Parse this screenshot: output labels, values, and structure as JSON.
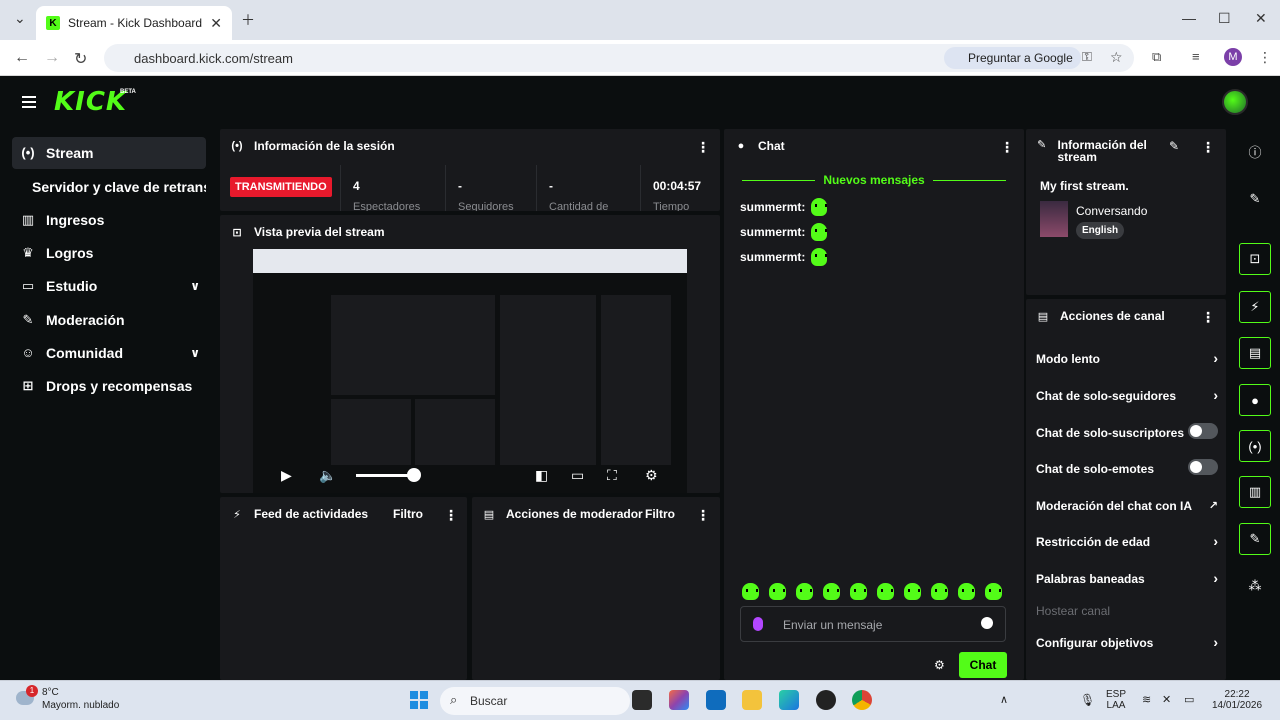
{
  "browser": {
    "tab_title": "Stream - Kick Dashboard",
    "url": "dashboard.kick.com/stream",
    "ask_google": "Preguntar a Google",
    "profile_letter": "M"
  },
  "app": {
    "logo": "KICK",
    "beta": "BETA"
  },
  "sidebar": {
    "items": [
      {
        "label": "Stream"
      },
      {
        "label": "Servidor y clave de retransmisión"
      },
      {
        "label": "Ingresos"
      },
      {
        "label": "Logros"
      },
      {
        "label": "Estudio"
      },
      {
        "label": "Moderación"
      },
      {
        "label": "Comunidad"
      },
      {
        "label": "Drops y recompensas"
      }
    ]
  },
  "session": {
    "title": "Información de la sesión",
    "live_badge": "TRANSMITIENDO",
    "stats": [
      {
        "value": "4",
        "label": "Espectadores"
      },
      {
        "value": "-",
        "label": "Seguidores"
      },
      {
        "value": "-",
        "label": "Cantidad de"
      },
      {
        "value": "00:04:57",
        "label": "Tiempo"
      }
    ]
  },
  "preview": {
    "title": "Vista previa del stream"
  },
  "activity": {
    "title": "Feed de actividades",
    "filter": "Filtro"
  },
  "mod_actions": {
    "title": "Acciones de moderador",
    "filter": "Filtro"
  },
  "chat": {
    "title": "Chat",
    "new_messages": "Nuevos mensajes",
    "messages": [
      {
        "user": "summermt:"
      },
      {
        "user": "summermt:"
      },
      {
        "user": "summermt:"
      }
    ],
    "input_placeholder": "Enviar un mensaje",
    "send_label": "Chat"
  },
  "stream_info": {
    "title": "Información del stream",
    "stream_title": "My first stream.",
    "category": "Conversando",
    "language": "English"
  },
  "channel_actions": {
    "title": "Acciones de canal",
    "items": [
      {
        "label": "Modo lento",
        "control": "chevron"
      },
      {
        "label": "Chat de solo-seguidores",
        "control": "chevron"
      },
      {
        "label": "Chat de solo-suscriptores",
        "control": "toggle"
      },
      {
        "label": "Chat de solo-emotes",
        "control": "toggle"
      },
      {
        "label": "Moderación del chat con IA",
        "control": "external"
      },
      {
        "label": "Restricción de edad",
        "control": "chevron"
      },
      {
        "label": "Palabras baneadas",
        "control": "chevron"
      },
      {
        "label": "Hostear canal",
        "control": "none"
      },
      {
        "label": "Configurar objetivos",
        "control": "chevron"
      }
    ]
  },
  "taskbar": {
    "temperature": "8°C",
    "condition": "Mayorm. nublado",
    "weather_badge": "1",
    "search": "Buscar",
    "lang": "ESP",
    "lang2": "LAA",
    "time": "22:22",
    "date": "14/01/2026"
  },
  "colors": {
    "brand": "#53fc18",
    "live": "#e8192c",
    "panel": "#18191c"
  }
}
